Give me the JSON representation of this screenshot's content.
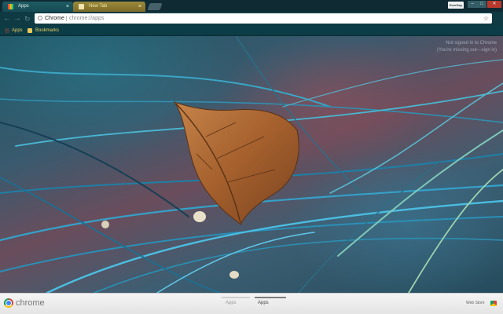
{
  "browser": {
    "tabs": [
      {
        "title": "Apps",
        "active": true
      },
      {
        "title": "New Tab",
        "active": false
      }
    ],
    "profile_label": "EverDay",
    "window_controls": [
      "minimize-icon",
      "maximize-icon",
      "close-icon"
    ]
  },
  "toolbar": {
    "nav_icons": [
      "back-arrow-icon",
      "forward-arrow-icon",
      "reload-icon"
    ],
    "omnibox": {
      "scheme_label": "Chrome",
      "url": "chrome://apps",
      "star_icon": "bookmark-star-icon"
    }
  },
  "bookmarks_bar": {
    "items": [
      {
        "label": "Apps",
        "icon": "apps-grid-icon"
      },
      {
        "label": "Bookmarks",
        "icon": "folder-icon"
      }
    ]
  },
  "content": {
    "signin_line1": "Not signed in to Chrome",
    "signin_line2": "(You're missing out—sign in)",
    "wallpaper": "dry leaf on blue grass stems"
  },
  "bottom_bar": {
    "brand": "chrome",
    "pages": [
      {
        "label": "Apps",
        "selected": false
      },
      {
        "label": "Apps",
        "selected": true
      }
    ],
    "webstore_label": "Web Store"
  },
  "colors": {
    "tab_active": "#1f5b63",
    "tab_inactive": "#9b8a3b",
    "toolbar": "#0f3a44",
    "bookmark_text": "#f0d060",
    "close_button": "#b8392c"
  }
}
